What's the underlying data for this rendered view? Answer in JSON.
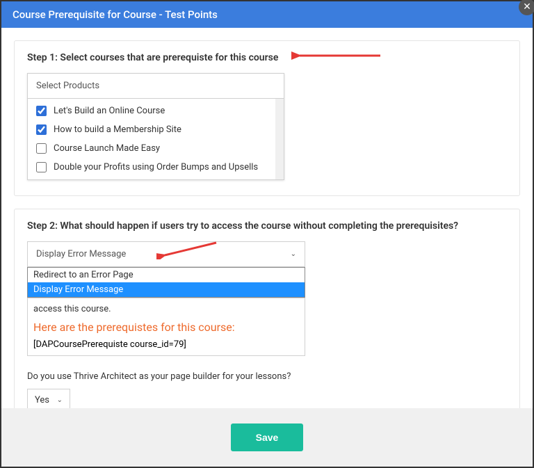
{
  "header": {
    "title": "Course Prerequisite for Course - Test Points"
  },
  "step1": {
    "title": "Step 1: Select courses that are prerequiste for this course",
    "products_header": "Select Products",
    "products": [
      {
        "label": "Let's Build an Online Course",
        "checked": true
      },
      {
        "label": "How to build a Membership Site",
        "checked": true
      },
      {
        "label": "Course Launch Made Easy",
        "checked": false
      },
      {
        "label": "Double your Profits using Order Bumps and Upsells",
        "checked": false
      }
    ]
  },
  "step2": {
    "title": "Step 2: What should happen if users try to access the course without completing the prerequisites?",
    "select_value": "Display Error Message",
    "options": [
      {
        "label": "Redirect to an Error Page",
        "selected": false
      },
      {
        "label": "Display Error Message",
        "selected": true
      }
    ],
    "message_box": {
      "partial_line": "access this course.",
      "orange_text": "Here are the prerequistes for this course:",
      "shortcode": "[DAPCoursePrerequiste course_id=79]"
    },
    "thrive_question": "Do you use Thrive Architect as your page builder for your lessons?",
    "thrive_value": "Yes"
  },
  "footer": {
    "save_label": "Save"
  }
}
